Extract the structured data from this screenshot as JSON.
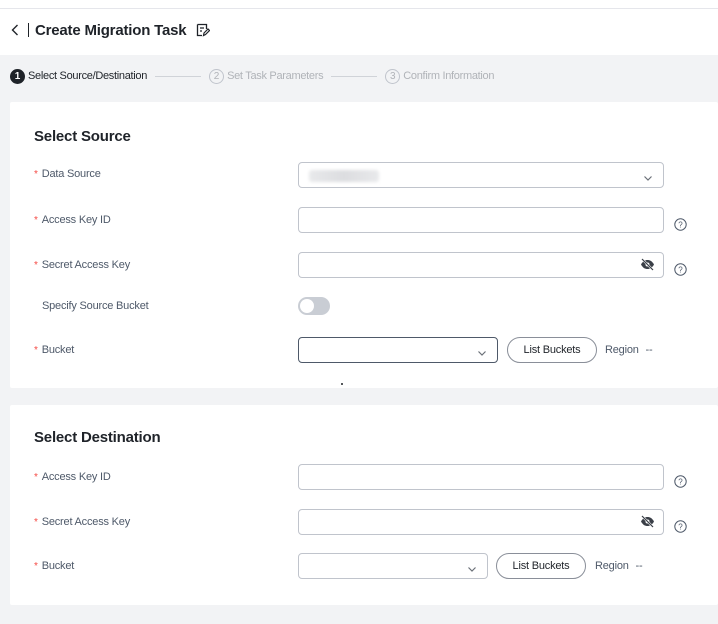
{
  "header": {
    "title": "Create Migration Task"
  },
  "steps": [
    {
      "number": "1",
      "label": "Select Source/Destination",
      "state": "active"
    },
    {
      "number": "2",
      "label": "Set Task Parameters",
      "state": "inactive"
    },
    {
      "number": "3",
      "label": "Confirm Information",
      "state": "inactive"
    }
  ],
  "source": {
    "title": "Select Source",
    "data_source": {
      "label": "Data Source",
      "value": ""
    },
    "access_key": {
      "label": "Access Key ID",
      "value": ""
    },
    "secret_key": {
      "label": "Secret Access Key",
      "value": ""
    },
    "specify_bucket": {
      "label": "Specify Source Bucket",
      "enabled": false
    },
    "bucket": {
      "label": "Bucket",
      "value": "",
      "list_button": "List Buckets",
      "region_label": "Region",
      "region_value": "--"
    }
  },
  "destination": {
    "title": "Select Destination",
    "access_key": {
      "label": "Access Key ID",
      "value": ""
    },
    "secret_key": {
      "label": "Secret Access Key",
      "value": ""
    },
    "bucket": {
      "label": "Bucket",
      "value": "",
      "list_button": "List Buckets",
      "region_label": "Region",
      "region_value": "--"
    }
  },
  "required_marker": "*",
  "colors": {
    "required": "#f54a45",
    "active_step": "#1f2329",
    "inactive_step": "#b0b3b8",
    "background": "#f2f3f5"
  }
}
